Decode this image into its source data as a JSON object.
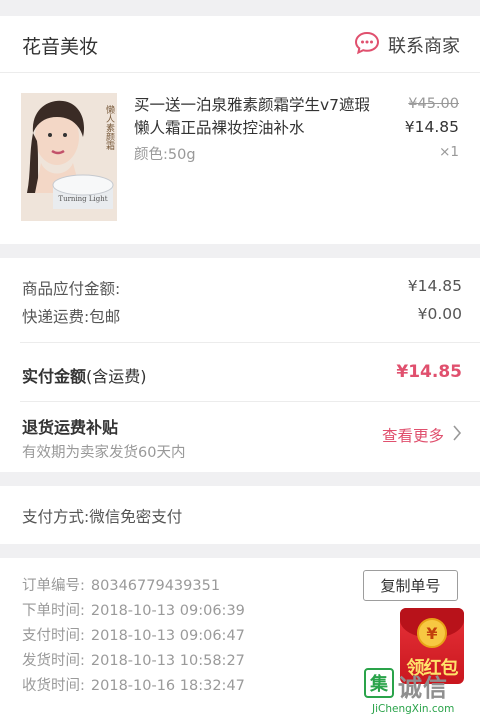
{
  "shop": {
    "name": "花音美妆",
    "contact_label": "联系商家"
  },
  "product": {
    "image_text": "懒人素颜霜",
    "image_brand": "7 Turning Light",
    "title": "买一送一泊泉雅素颜霜学生v7遮瑕懒人霜正品裸妆控油补水",
    "variant": "颜色:50g",
    "original_price": "¥45.00",
    "price": "¥14.85",
    "quantity": "×1"
  },
  "summary": {
    "goods_amount_label": "商品应付金额:",
    "goods_amount_value": "¥14.85",
    "shipping_label": "快递运费:包邮",
    "shipping_value": "¥0.00",
    "paid_label": "实付金额",
    "paid_note": "(含运费)",
    "paid_value": "¥14.85",
    "refund_title": "退货运费补贴",
    "refund_sub": "有效期为卖家发货60天内",
    "more_label": "查看更多"
  },
  "payment": {
    "method_label": "支付方式:",
    "method_value": "微信免密支付"
  },
  "order": {
    "copy_label": "复制单号",
    "rows": [
      {
        "label": "订单编号:",
        "value": "80346779439351"
      },
      {
        "label": "下单时间:",
        "value": "2018-10-13  09:06:39"
      },
      {
        "label": "支付时间:",
        "value": "2018-10-13  09:06:47"
      },
      {
        "label": "发货时间:",
        "value": "2018-10-13  10:58:27"
      },
      {
        "label": "收货时间:",
        "value": "2018-10-16  18:32:47"
      }
    ]
  },
  "red_packet": {
    "coin": "¥",
    "label": "领红包"
  },
  "watermark": {
    "logo": "集",
    "text": "诚信",
    "url": "JiChengXin.com"
  },
  "colors": {
    "accent": "#e0506e",
    "background": "#f0f0f2",
    "muted": "#999999"
  }
}
